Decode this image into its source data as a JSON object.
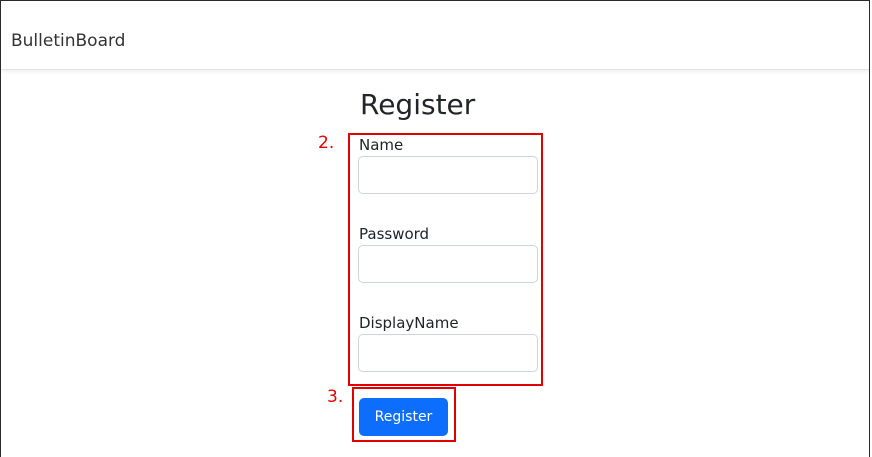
{
  "navbar": {
    "brand": "BulletinBoard"
  },
  "form": {
    "title": "Register",
    "fields": [
      {
        "label": "Name",
        "value": ""
      },
      {
        "label": "Password",
        "value": ""
      },
      {
        "label": "DisplayName",
        "value": ""
      }
    ],
    "submit_label": "Register"
  },
  "annotations": {
    "marker_fields": "2.",
    "marker_button": "3.",
    "color": "#e00000"
  },
  "colors": {
    "primary_button": "#0d6efd"
  }
}
